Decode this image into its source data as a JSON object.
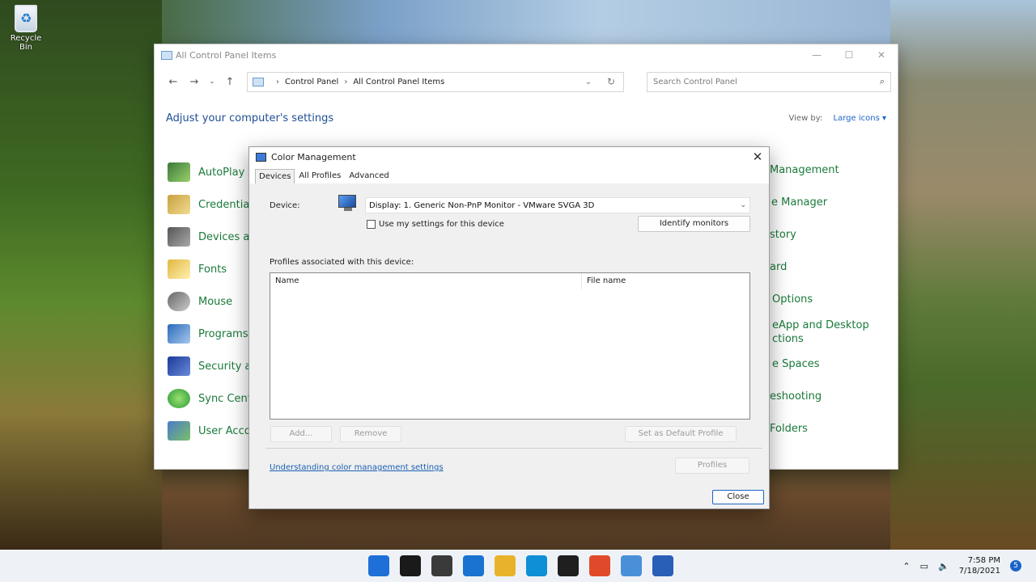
{
  "desktop": {
    "recycle_bin_label": "Recycle Bin"
  },
  "control_panel": {
    "title": "All Control Panel Items",
    "breadcrumb": [
      "Control Panel",
      "All Control Panel Items"
    ],
    "search_placeholder": "Search Control Panel",
    "heading": "Adjust your computer's settings",
    "view_by_label": "View by:",
    "view_by_value": "Large icons",
    "left_items": [
      "AutoPlay",
      "Credential",
      "Devices ar",
      "Fonts",
      "Mouse",
      "Programs",
      "Security ar",
      "Sync Cent",
      "User Acco"
    ],
    "right_items": [
      "Management",
      "e Manager",
      "story",
      "ard",
      "Options",
      "eApp and Desktop",
      "ctions",
      "e Spaces",
      "eshooting",
      "Folders"
    ]
  },
  "color_dialog": {
    "title": "Color Management",
    "tabs": [
      "Devices",
      "All Profiles",
      "Advanced"
    ],
    "device_label": "Device:",
    "device_value": "Display: 1. Generic Non-PnP Monitor - VMware SVGA 3D",
    "use_settings_label": "Use my settings for this device",
    "identify_button": "Identify monitors",
    "profiles_label": "Profiles associated with this device:",
    "columns": [
      "Name",
      "File name"
    ],
    "add_button": "Add...",
    "remove_button": "Remove",
    "set_default_button": "Set as Default Profile",
    "link_text": "Understanding color management settings",
    "profiles_button": "Profiles",
    "close_button": "Close"
  },
  "taskbar": {
    "time": "7:58 PM",
    "date": "7/18/2021",
    "notification_count": "5",
    "icon_colors": [
      "#1f6fd8",
      "#1a1a1a",
      "#3a3a3a",
      "#1a73d1",
      "#e8b32a",
      "#0f8fd6",
      "#1f1f1f",
      "#e04a2a",
      "#4a90d9",
      "#2a5fb8"
    ]
  }
}
